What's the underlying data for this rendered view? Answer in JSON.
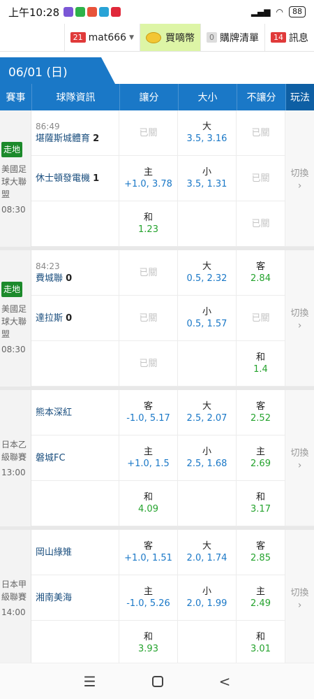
{
  "status": {
    "time": "上午10:28",
    "battery": "88"
  },
  "topnav": {
    "user_badge": "21",
    "username": "mat666",
    "buy_label": "買嘀幣",
    "cart_badge": "0",
    "cart_label": "購牌清單",
    "msg_badge": "14",
    "msg_label": "訊息"
  },
  "date": "06/01 (日)",
  "headers": [
    "賽事",
    "球隊資訊",
    "讓分",
    "大小",
    "不讓分",
    "玩法"
  ],
  "switch_label": "切換",
  "matches": [
    {
      "live": "走地",
      "league": "美國足球大聯盟",
      "time": "08:30",
      "clock": "86:49",
      "home": "堪薩斯城體育",
      "home_score": "2",
      "away": "休士頓發電機",
      "away_score": "1",
      "rows": [
        {
          "hcp": {
            "closed": "已關"
          },
          "ou": {
            "label": "大",
            "value": "3.5, 3.16"
          },
          "ml": {
            "closed": "已關"
          }
        },
        {
          "hcp": {
            "label": "主",
            "value": "+1.0, 3.78"
          },
          "ou": {
            "label": "小",
            "value": "3.5, 1.31"
          },
          "ml": {
            "closed": "已關"
          }
        },
        {
          "hcp": {
            "label": "和",
            "value": "1.23"
          },
          "ou": {},
          "ml": {
            "closed": "已關"
          }
        }
      ]
    },
    {
      "live": "走地",
      "league": "美國足球大聯盟",
      "time": "08:30",
      "clock": "84:23",
      "home": "費城聯",
      "home_score": "0",
      "away": "達拉斯",
      "away_score": "0",
      "rows": [
        {
          "hcp": {
            "closed": "已關"
          },
          "ou": {
            "label": "大",
            "value": "0.5, 2.32"
          },
          "ml": {
            "label": "客",
            "value": "2.84"
          }
        },
        {
          "hcp": {
            "closed": "已關"
          },
          "ou": {
            "label": "小",
            "value": "0.5, 1.57"
          },
          "ml": {
            "closed": "已關"
          }
        },
        {
          "hcp": {
            "closed": "已關"
          },
          "ou": {},
          "ml": {
            "label": "和",
            "value": "1.4"
          }
        }
      ]
    },
    {
      "live": "",
      "league": "日本乙級聯賽",
      "time": "13:00",
      "clock": "",
      "home": "熊本深紅",
      "home_score": "",
      "away": "磐城FC",
      "away_score": "",
      "rows": [
        {
          "hcp": {
            "label": "客",
            "value": "-1.0, 5.17"
          },
          "ou": {
            "label": "大",
            "value": "2.5, 2.07"
          },
          "ml": {
            "label": "客",
            "value": "2.52"
          }
        },
        {
          "hcp": {
            "label": "主",
            "value": "+1.0, 1.5"
          },
          "ou": {
            "label": "小",
            "value": "2.5, 1.68"
          },
          "ml": {
            "label": "主",
            "value": "2.69"
          }
        },
        {
          "hcp": {
            "label": "和",
            "value": "4.09"
          },
          "ou": {},
          "ml": {
            "label": "和",
            "value": "3.17"
          }
        }
      ]
    },
    {
      "live": "",
      "league": "日本甲級聯賽",
      "time": "14:00",
      "clock": "",
      "home": "岡山綠雉",
      "home_score": "",
      "away": "湘南美海",
      "away_score": "",
      "rows": [
        {
          "hcp": {
            "label": "客",
            "value": "+1.0, 1.51"
          },
          "ou": {
            "label": "大",
            "value": "2.0, 1.74"
          },
          "ml": {
            "label": "客",
            "value": "2.85"
          }
        },
        {
          "hcp": {
            "label": "主",
            "value": "-1.0, 5.26"
          },
          "ou": {
            "label": "小",
            "value": "2.0, 1.99"
          },
          "ml": {
            "label": "主",
            "value": "2.49"
          }
        },
        {
          "hcp": {
            "label": "和",
            "value": "3.93"
          },
          "ou": {},
          "ml": {
            "label": "和",
            "value": "3.01"
          }
        }
      ]
    }
  ],
  "colors": {
    "accent": "#1a78c7",
    "live": "#1c8a2b",
    "badge": "#e03a3a",
    "odds_green": "#25a32e"
  }
}
